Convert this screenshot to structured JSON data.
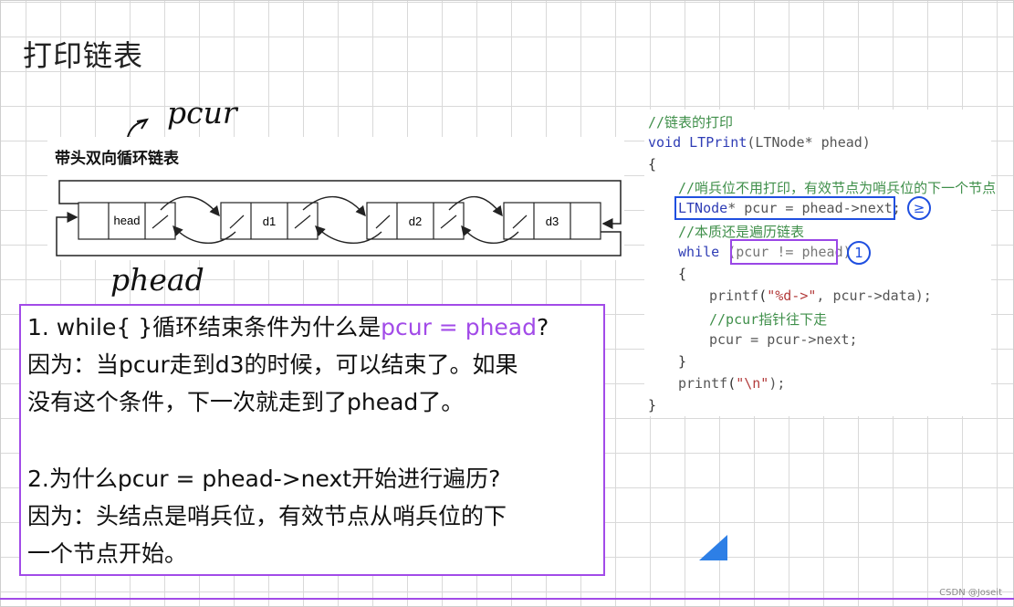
{
  "page": {
    "title": "打印链表"
  },
  "handwriting": {
    "pcur": "pcur",
    "phead": "phead"
  },
  "diagram": {
    "title": "带头双向循环链表",
    "nodes": [
      "head",
      "d1",
      "d2",
      "d3"
    ]
  },
  "code": {
    "comment_header": "//链表的打印",
    "signature": {
      "ret": "void",
      "name": "LTPrint",
      "params": "(LTNode* phead)"
    },
    "open_brace": "{",
    "comment_sentinel": "//哨兵位不用打印，有效节点为哨兵位的下一个节点",
    "decl": {
      "type": "LTNode",
      "rest": "* pcur = phead->next;"
    },
    "comment_essence": "//本质还是遍历链表",
    "while": {
      "kw": "while",
      "cond": "(pcur != phead)"
    },
    "inner_open": "{",
    "printf_line": {
      "fn": "printf",
      "str": "\"%d->\"",
      "rest": ", pcur->data);"
    },
    "comment_move": "//pcur指针往下走",
    "advance": "pcur = pcur->next;",
    "inner_close": "}",
    "printf_newline": {
      "fn": "printf",
      "str": "\"\\n\"",
      "rest": ");"
    },
    "close_brace": "}"
  },
  "annotations": {
    "ge": "≥",
    "one": "1"
  },
  "notes": {
    "line1_prefix": "1. while{ }循环结束条件为什么是",
    "line1_highlight": "pcur = phead",
    "line1_suffix": "?",
    "line2": "因为：当pcur走到d3的时候，可以结束了。如果",
    "line3": "没有这个条件，下一次就走到了phead了。",
    "line4": "2.为什么pcur = phead->next开始进行遍历?",
    "line5": "因为：头结点是哨兵位，有效节点从哨兵位的下",
    "line6": "一个节点开始。"
  },
  "watermark": "CSDN @Joseit",
  "colors": {
    "purple": "#a24be8",
    "blue": "#1f4fe0",
    "triangle": "#2d7fe6"
  }
}
